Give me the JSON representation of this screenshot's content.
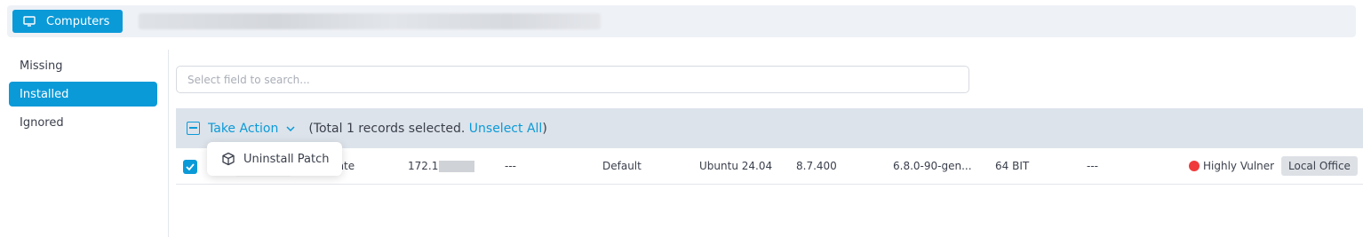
{
  "header": {
    "computers_label": "Computers",
    "computers_icon": "monitor-icon"
  },
  "sidebar": {
    "items": [
      {
        "label": "Missing",
        "active": false
      },
      {
        "label": "Installed",
        "active": true
      },
      {
        "label": "Ignored",
        "active": false
      }
    ]
  },
  "search": {
    "placeholder": "Select field to search..."
  },
  "action_bar": {
    "take_action_label": "Take Action",
    "selection_prefix": "(Total 1 records selected.",
    "unselect_label": "Unselect All",
    "selection_suffix": ")"
  },
  "dropdown": {
    "items": [
      {
        "label": "Uninstall Patch",
        "icon": "package-icon"
      }
    ]
  },
  "table": {
    "rows": [
      {
        "selected": true,
        "name_partial": "mate",
        "ip_partial": "172.1",
        "col3": "---",
        "group": "Default",
        "os": "Ubuntu 24.04",
        "agent_version": "8.7.400",
        "kernel": "6.8.0-90-gen...",
        "arch": "64 BIT",
        "col9": "---",
        "vulnerability": "Highly Vulnerable",
        "location": "Local Office"
      }
    ]
  },
  "colors": {
    "accent": "#0b9ad8",
    "danger": "#ef3b3b",
    "action_bar_bg": "#dde3ea"
  }
}
